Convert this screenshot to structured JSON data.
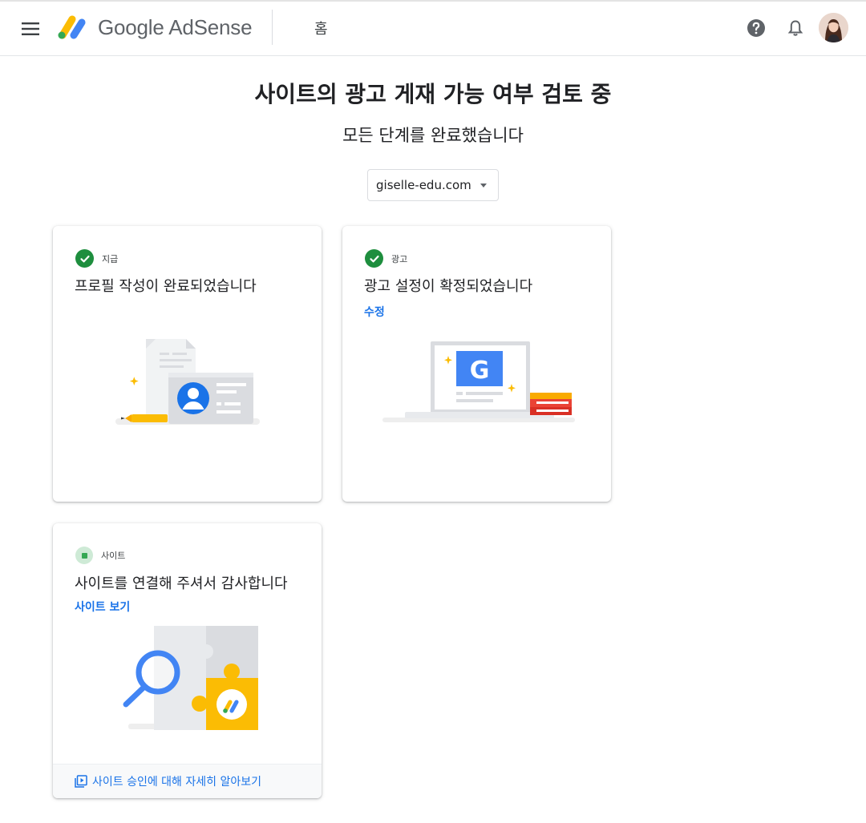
{
  "app": {
    "brand": "Google AdSense",
    "page_tab": "홈"
  },
  "header": {
    "icons": [
      "menu-icon",
      "adsense-logo-icon",
      "help-icon",
      "notifications-bell-icon",
      "avatar"
    ]
  },
  "main": {
    "title": "사이트의 광고 게재 가능 여부 검토 중",
    "subtitle": "모든 단계를 완료했습니다",
    "site_selector": {
      "value": "giselle-edu.com"
    }
  },
  "cards": [
    {
      "status": "complete",
      "status_label": "지급",
      "title": "프로필 작성이 완료되었습니다",
      "illustration": "profile-card-illustration"
    },
    {
      "status": "complete",
      "status_label": "광고",
      "title": "광고 설정이 확정되었습니다",
      "link": "수정",
      "illustration": "laptop-google-illustration"
    },
    {
      "status": "in-progress",
      "status_label": "사이트",
      "title": "사이트를 연결해 주셔서 감사합니다",
      "link": "사이트 보기",
      "illustration": "puzzle-search-illustration",
      "footer_link": "사이트 승인에 대해 자세히 알아보기"
    }
  ],
  "colors": {
    "primary_link": "#1a73e8",
    "success": "#1e8e3e",
    "pending_bg": "#ceead6",
    "brand_yellow": "#fbbc04",
    "brand_blue": "#4285f4",
    "brand_green": "#34a853"
  }
}
